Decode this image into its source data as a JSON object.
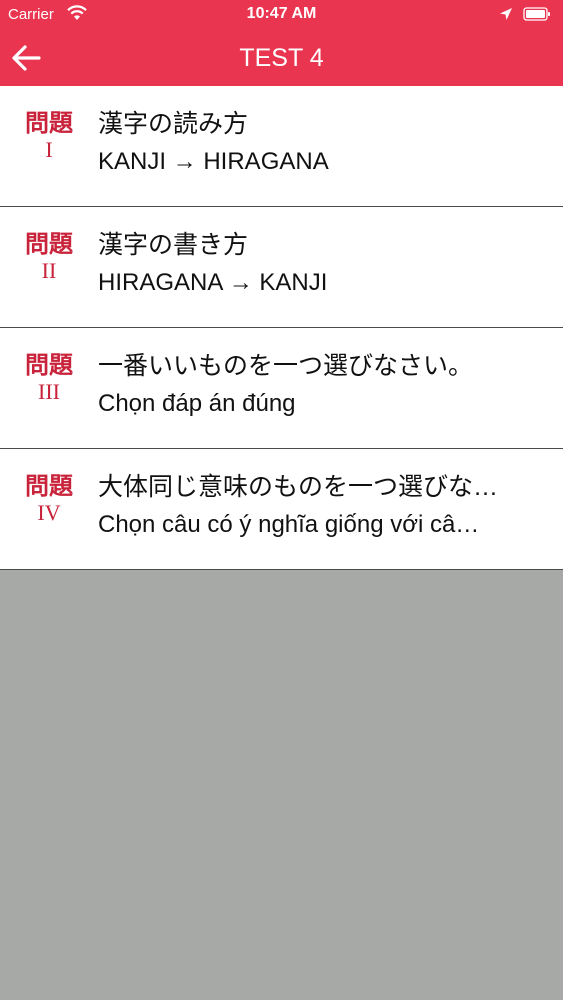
{
  "status_bar": {
    "carrier": "Carrier",
    "time": "10:47 AM",
    "icons": [
      "wifi-icon",
      "location-arrow-icon",
      "battery-icon"
    ]
  },
  "nav": {
    "title": "TEST 4",
    "back_icon": "arrow-left-icon"
  },
  "colors": {
    "accent": "#ea3550",
    "badge_text": "#c8233a",
    "background_empty": "#a6a9a5"
  },
  "items": [
    {
      "badge_kanji": "問題",
      "badge_roman": "I",
      "title_jp": "漢字の読み方",
      "subtitle": "KANJI → HIRAGANA"
    },
    {
      "badge_kanji": "問題",
      "badge_roman": "II",
      "title_jp": "漢字の書き方",
      "subtitle": "HIRAGANA → KANJI"
    },
    {
      "badge_kanji": "問題",
      "badge_roman": "III",
      "title_jp": "一番いいものを一つ選びなさい。",
      "subtitle": "Chọn đáp án đúng"
    },
    {
      "badge_kanji": "問題",
      "badge_roman": "IV",
      "title_jp": "大体同じ意味のものを一つ選びな…",
      "subtitle": "Chọn câu có ý nghĩa giống với câ…"
    }
  ]
}
